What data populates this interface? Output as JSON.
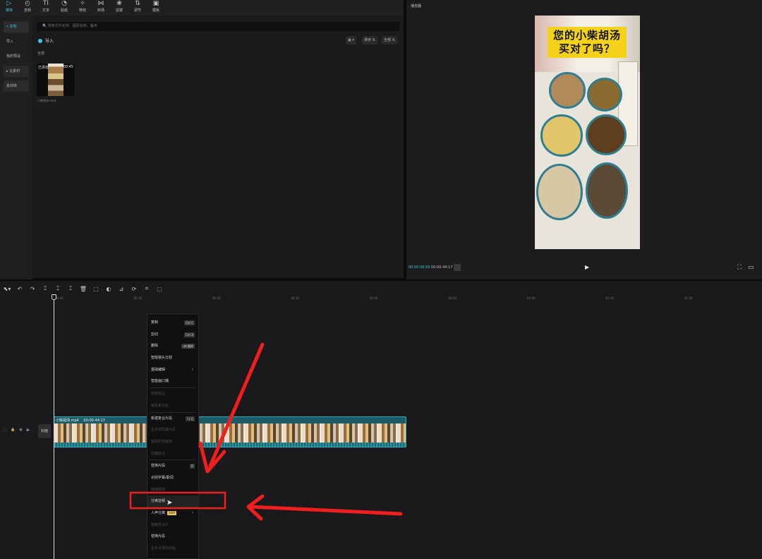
{
  "toolbar": {
    "tabs": [
      {
        "label": "媒体",
        "icon": "media-icon",
        "glyph": "▷"
      },
      {
        "label": "音频",
        "icon": "audio-icon",
        "glyph": "◴"
      },
      {
        "label": "文本",
        "icon": "text-icon",
        "glyph": "TI"
      },
      {
        "label": "贴纸",
        "icon": "sticker-icon",
        "glyph": "◔"
      },
      {
        "label": "特效",
        "icon": "effects-icon",
        "glyph": "✧"
      },
      {
        "label": "转场",
        "icon": "transition-icon",
        "glyph": "⋈"
      },
      {
        "label": "滤镜",
        "icon": "filter-icon",
        "glyph": "❀"
      },
      {
        "label": "调节",
        "icon": "adjust-icon",
        "glyph": "⇅"
      },
      {
        "label": "模板",
        "icon": "template-icon",
        "glyph": "▣"
      }
    ]
  },
  "media_nav": {
    "items": [
      "• 本地",
      "导入",
      "我的预设",
      "▸ 云素材",
      "素材库"
    ]
  },
  "media": {
    "search_placeholder": "🔍 搜索文件名称、图层名称、备用",
    "import_label": "导入",
    "view_label": "▦ ▾",
    "sort_label": "排序 ⇅",
    "filter_label": "全部 ⇅",
    "all_label": "全部",
    "thumb_added": "已添加",
    "thumb_duration": "00:45",
    "file_name": "小柴胡汤.mp4"
  },
  "player": {
    "title": "播放器",
    "banner_line1": "您的小柴胡汤",
    "banner_line2": "买对了吗？",
    "time_current": "00:00:00:00",
    "time_total": "00:00:44:17",
    "play_icon": "▶",
    "fullscreen_icon": "⛶",
    "ratio_icon": "▭"
  },
  "timeline": {
    "tools": [
      "⬉▾",
      "↶",
      "↷",
      "⌶",
      "⌶",
      "⌶",
      "🗑",
      "⬚",
      "◐",
      "⊿",
      "⟳",
      "⌗",
      "⬚"
    ],
    "ticks": [
      "00:00",
      "00:10",
      "00:20",
      "00:30",
      "00:40",
      "00:50",
      "01:00",
      "01:10",
      "01:20"
    ],
    "track_controls": [
      "⬚",
      "🔒",
      "◉",
      "🔈"
    ],
    "cover_label": "封面",
    "clip_name": "小柴胡汤.mp4",
    "clip_duration": "00:00:44:17"
  },
  "context_menu": {
    "items": [
      {
        "label": "复制",
        "shortcut": "Ctrl C",
        "disabled": false
      },
      {
        "label": "剪切",
        "shortcut": "Ctrl X",
        "disabled": false
      },
      {
        "label": "删除",
        "shortcut": "⌫ 删除",
        "disabled": false
      },
      {
        "label": "智能镜头分割",
        "disabled": false
      },
      {
        "label": "基础编辑",
        "submenu": true,
        "disabled": false
      },
      {
        "label": "智能画口播",
        "disabled": false
      },
      {
        "separator": true
      },
      {
        "label": "启用组合",
        "disabled": true
      },
      {
        "label": "解除复合段",
        "disabled": true
      },
      {
        "separator": true
      },
      {
        "label": "新建复合片段",
        "shortcut": "⌥ G",
        "disabled": false
      },
      {
        "label": "显示和隐藏片段",
        "disabled": true
      },
      {
        "label": "解除所有链接",
        "disabled": true
      },
      {
        "label": "隐藏标注",
        "disabled": true
      },
      {
        "separator": true
      },
      {
        "label": "替换片段",
        "shortcut": "R",
        "disabled": false
      },
      {
        "label": "识别字幕/歌词",
        "disabled": false
      },
      {
        "label": "链接媒体",
        "disabled": true
      },
      {
        "label": "分离音频",
        "disabled": false,
        "highlighted": true
      },
      {
        "label": "人声分离",
        "vip": "SVIP",
        "submenu": true,
        "disabled": false
      },
      {
        "label": "链接复合片",
        "disabled": true
      },
      {
        "label": "替换片段",
        "disabled": false
      },
      {
        "label": "显示关键帧动画",
        "disabled": true
      }
    ]
  },
  "annotations": {
    "arrow_color": "#f01e1e",
    "box_color": "#f01e1e"
  }
}
